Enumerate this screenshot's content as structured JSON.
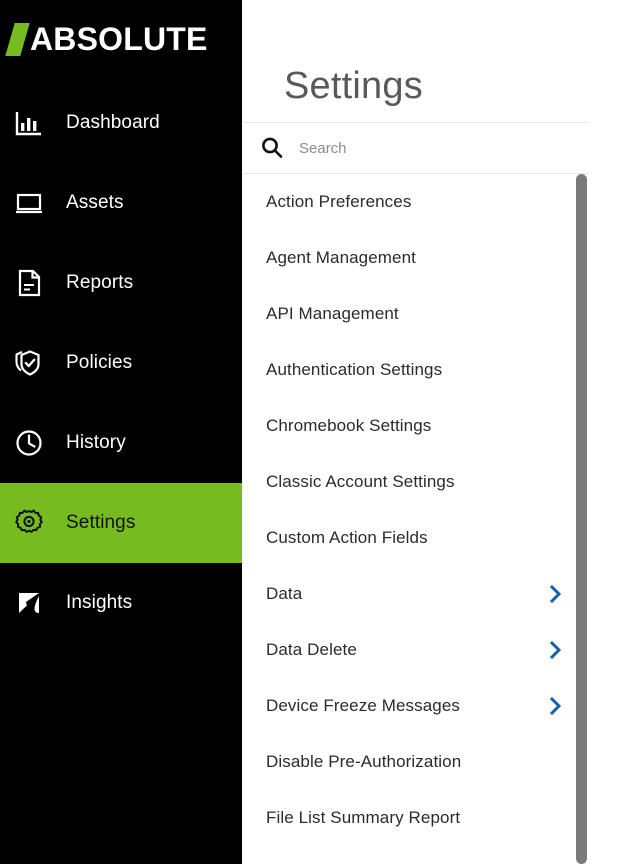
{
  "brand": {
    "name": "ABSOLUTE",
    "accent_green": "#76bc21",
    "slash_icon": "slash-mark"
  },
  "sidebar": {
    "items": [
      {
        "label": "Dashboard",
        "icon": "bar-chart-icon",
        "active": false
      },
      {
        "label": "Assets",
        "icon": "laptop-icon",
        "active": false
      },
      {
        "label": "Reports",
        "icon": "document-icon",
        "active": false
      },
      {
        "label": "Policies",
        "icon": "shield-check-icon",
        "active": false
      },
      {
        "label": "History",
        "icon": "clock-icon",
        "active": false
      },
      {
        "label": "Settings",
        "icon": "gear-icon",
        "active": true
      },
      {
        "label": "Insights",
        "icon": "insights-k-icon",
        "active": false
      }
    ]
  },
  "header": {
    "title": "Settings"
  },
  "search": {
    "placeholder": "Search",
    "value": "",
    "icon": "search-icon"
  },
  "menu": {
    "chevron_color": "#1560ad",
    "items": [
      {
        "label": "Action Preferences",
        "has_submenu": false
      },
      {
        "label": "Agent Management",
        "has_submenu": false
      },
      {
        "label": "API Management",
        "has_submenu": false
      },
      {
        "label": "Authentication Settings",
        "has_submenu": false
      },
      {
        "label": "Chromebook Settings",
        "has_submenu": false
      },
      {
        "label": "Classic Account Settings",
        "has_submenu": false
      },
      {
        "label": "Custom Action Fields",
        "has_submenu": false
      },
      {
        "label": "Data",
        "has_submenu": true
      },
      {
        "label": "Data Delete",
        "has_submenu": true
      },
      {
        "label": "Device Freeze Messages",
        "has_submenu": true
      },
      {
        "label": "Disable Pre-Authorization",
        "has_submenu": false
      },
      {
        "label": "File List Summary Report",
        "has_submenu": false
      }
    ]
  },
  "scrollbar": {
    "orientation": "vertical",
    "thumb_color": "#7a7a7a"
  }
}
